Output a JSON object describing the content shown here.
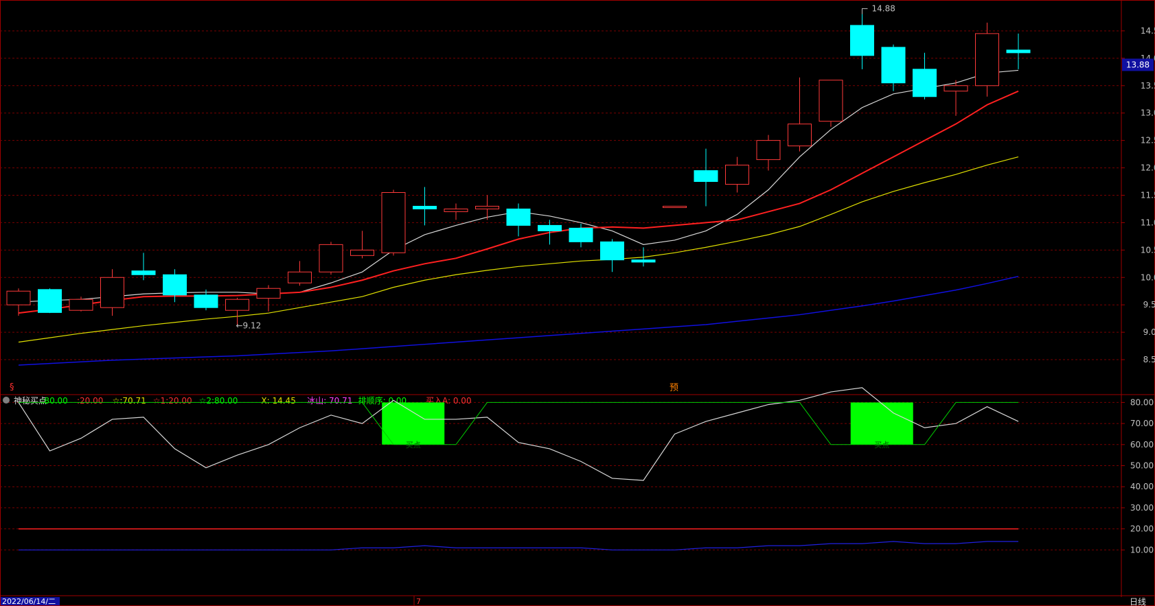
{
  "colors": {
    "background": "#000000",
    "grid": "#7a0000",
    "border": "#a00000",
    "axis_text": "#c0c0c0",
    "up_candle": "#ff3a3a",
    "down_candle": "#00ffff",
    "ma5": "#d8d8d8",
    "ma10": "#ff2020",
    "ma20": "#e0e000",
    "ma60": "#1010e0",
    "buy_fill": "#00ff00",
    "osc_line": "#d8d8d8",
    "osc_step": "#00cc00",
    "level20": "#ff2020",
    "level10": "#2020e0"
  },
  "header": {
    "indicator_name": "神秘买点",
    "p1_label": ":",
    "p1_value": "80.00",
    "p2_label": ":",
    "p2_value": "20.00",
    "p3_label": "☆:",
    "p3_value": "70.71",
    "p4_label": "☆1:",
    "p4_value": "20.00",
    "p5_label": "☆2:",
    "p5_value": "80.00",
    "x_label": "X:",
    "x_value": "14.45",
    "bingshan_label": "冰山:",
    "bingshan_value": "70.71",
    "paishunxu_label": "排顺序:",
    "paishunxu_value": "0.00",
    "mairu_label": "买入A:",
    "mairu_value": "0.00"
  },
  "footer": {
    "date": "2022/06/14/二",
    "month_mark": "7",
    "period": "日线"
  },
  "markers": {
    "top_left": "§",
    "top_mid": "预"
  },
  "chart_data": [
    {
      "type": "candlestick",
      "panel": "main",
      "ylim": [
        8.2,
        14.9
      ],
      "yticks": [
        "8.50",
        "9.00",
        "9.50",
        "10.00",
        "10.50",
        "11.00",
        "11.50",
        "12.00",
        "12.50",
        "13.00",
        "13.50",
        "14.00",
        "14.50"
      ],
      "current_price": "13.88",
      "high_label": "14.88",
      "low_label": "9.12",
      "candles": [
        {
          "o": 9.5,
          "h": 9.8,
          "l": 9.3,
          "c": 9.75
        },
        {
          "o": 9.78,
          "h": 9.8,
          "l": 9.35,
          "c": 9.36
        },
        {
          "o": 9.4,
          "h": 9.65,
          "l": 9.38,
          "c": 9.6
        },
        {
          "o": 9.45,
          "h": 10.15,
          "l": 9.3,
          "c": 10.0
        },
        {
          "o": 10.12,
          "h": 10.45,
          "l": 9.95,
          "c": 10.05
        },
        {
          "o": 10.05,
          "h": 10.15,
          "l": 9.55,
          "c": 9.68
        },
        {
          "o": 9.68,
          "h": 9.78,
          "l": 9.4,
          "c": 9.45
        },
        {
          "o": 9.4,
          "h": 9.63,
          "l": 9.12,
          "c": 9.6
        },
        {
          "o": 9.62,
          "h": 9.86,
          "l": 9.38,
          "c": 9.8
        },
        {
          "o": 9.9,
          "h": 10.3,
          "l": 9.85,
          "c": 10.1
        },
        {
          "o": 10.1,
          "h": 10.65,
          "l": 10.05,
          "c": 10.6
        },
        {
          "o": 10.4,
          "h": 10.85,
          "l": 10.35,
          "c": 10.5
        },
        {
          "o": 10.45,
          "h": 11.6,
          "l": 10.4,
          "c": 11.55
        },
        {
          "o": 11.3,
          "h": 11.65,
          "l": 10.95,
          "c": 11.25
        },
        {
          "o": 11.2,
          "h": 11.35,
          "l": 11.05,
          "c": 11.25
        },
        {
          "o": 11.25,
          "h": 11.5,
          "l": 11.05,
          "c": 11.3
        },
        {
          "o": 11.25,
          "h": 11.35,
          "l": 10.75,
          "c": 10.95
        },
        {
          "o": 10.95,
          "h": 11.05,
          "l": 10.6,
          "c": 10.85
        },
        {
          "o": 10.9,
          "h": 10.98,
          "l": 10.55,
          "c": 10.65
        },
        {
          "o": 10.65,
          "h": 10.7,
          "l": 10.1,
          "c": 10.32
        },
        {
          "o": 10.32,
          "h": 10.55,
          "l": 10.2,
          "c": 10.28
        },
        {
          "o": 11.3,
          "h": 11.3,
          "l": 11.3,
          "c": 11.3
        },
        {
          "o": 11.95,
          "h": 12.35,
          "l": 11.3,
          "c": 11.75
        },
        {
          "o": 11.7,
          "h": 12.2,
          "l": 11.55,
          "c": 12.05
        },
        {
          "o": 12.15,
          "h": 12.6,
          "l": 11.95,
          "c": 12.5
        },
        {
          "o": 12.4,
          "h": 13.65,
          "l": 12.3,
          "c": 12.8
        },
        {
          "o": 12.85,
          "h": 13.6,
          "l": 12.75,
          "c": 13.6
        },
        {
          "o": 14.6,
          "h": 14.88,
          "l": 13.8,
          "c": 14.05
        },
        {
          "o": 14.2,
          "h": 14.25,
          "l": 13.4,
          "c": 13.55
        },
        {
          "o": 13.8,
          "h": 14.1,
          "l": 13.25,
          "c": 13.3
        },
        {
          "o": 13.4,
          "h": 13.6,
          "l": 12.95,
          "c": 13.5
        },
        {
          "o": 13.5,
          "h": 14.65,
          "l": 13.3,
          "c": 14.45
        },
        {
          "o": 14.15,
          "h": 14.45,
          "l": 13.8,
          "c": 14.1
        }
      ],
      "series": [
        {
          "name": "MA5",
          "values": [
            9.55,
            9.58,
            9.6,
            9.65,
            9.7,
            9.72,
            9.73,
            9.73,
            9.7,
            9.73,
            9.9,
            10.1,
            10.5,
            10.78,
            10.95,
            11.1,
            11.2,
            11.12,
            11.0,
            10.85,
            10.6,
            10.68,
            10.85,
            11.15,
            11.6,
            12.2,
            12.7,
            13.1,
            13.35,
            13.45,
            13.55,
            13.73,
            13.78
          ]
        },
        {
          "name": "MA10",
          "values": [
            9.35,
            9.42,
            9.5,
            9.58,
            9.65,
            9.66,
            9.66,
            9.67,
            9.7,
            9.73,
            9.82,
            9.95,
            10.12,
            10.25,
            10.35,
            10.52,
            10.7,
            10.82,
            10.9,
            10.92,
            10.9,
            10.95,
            11.0,
            11.05,
            11.2,
            11.35,
            11.6,
            11.9,
            12.2,
            12.5,
            12.8,
            13.15,
            13.4
          ]
        },
        {
          "name": "MA20",
          "values": [
            8.82,
            8.9,
            8.98,
            9.05,
            9.12,
            9.18,
            9.24,
            9.29,
            9.35,
            9.45,
            9.55,
            9.65,
            9.82,
            9.95,
            10.05,
            10.13,
            10.2,
            10.25,
            10.3,
            10.33,
            10.37,
            10.45,
            10.55,
            10.66,
            10.78,
            10.93,
            11.15,
            11.38,
            11.57,
            11.73,
            11.88,
            12.05,
            12.2
          ]
        },
        {
          "name": "MA60",
          "values": [
            8.4,
            8.43,
            8.46,
            8.49,
            8.51,
            8.53,
            8.55,
            8.57,
            8.6,
            8.63,
            8.66,
            8.7,
            8.74,
            8.78,
            8.82,
            8.86,
            8.9,
            8.94,
            8.98,
            9.02,
            9.06,
            9.1,
            9.14,
            9.2,
            9.26,
            9.32,
            9.4,
            9.48,
            9.57,
            9.67,
            9.77,
            9.89,
            10.02
          ]
        }
      ]
    },
    {
      "type": "line",
      "panel": "indicator",
      "ylim": [
        0,
        90
      ],
      "yticks": [
        "10.00",
        "20.00",
        "30.00",
        "40.00",
        "50.00",
        "60.00",
        "70.00",
        "80.00"
      ],
      "series": [
        {
          "name": "冰山",
          "values": [
            80,
            57,
            63,
            72,
            73,
            58,
            49,
            55,
            60,
            68,
            74,
            70,
            81,
            72,
            72,
            73,
            61,
            58,
            52,
            44,
            43,
            65,
            71,
            75,
            79,
            81,
            85,
            87,
            75,
            68,
            70,
            78,
            71
          ]
        },
        {
          "name": "☆2",
          "values": [
            80,
            80,
            80,
            80,
            80,
            80,
            80,
            80,
            80,
            80,
            80,
            80,
            60,
            60,
            60,
            80,
            80,
            80,
            80,
            80,
            80,
            80,
            80,
            80,
            80,
            80,
            60,
            60,
            60,
            60,
            80,
            80,
            80
          ]
        },
        {
          "name": "☆1",
          "values": [
            20,
            20,
            20,
            20,
            20,
            20,
            20,
            20,
            20,
            20,
            20,
            20,
            20,
            20,
            20,
            20,
            20,
            20,
            20,
            20,
            20,
            20,
            20,
            20,
            20,
            20,
            20,
            20,
            20,
            20,
            20,
            20,
            20
          ]
        },
        {
          "name": "",
          "values": [
            10,
            10,
            10,
            10,
            10,
            10,
            10,
            10,
            10,
            10,
            10,
            11,
            11,
            12,
            11,
            11,
            11,
            11,
            11,
            10,
            10,
            10,
            11,
            11,
            12,
            12,
            13,
            13,
            14,
            13,
            13,
            14,
            14
          ]
        }
      ],
      "buy_zones": [
        {
          "from": 12,
          "to": 13,
          "low": 60,
          "high": 80,
          "label": "买点"
        },
        {
          "from": 27,
          "to": 28,
          "low": 60,
          "high": 80,
          "label": "买点"
        }
      ]
    }
  ]
}
